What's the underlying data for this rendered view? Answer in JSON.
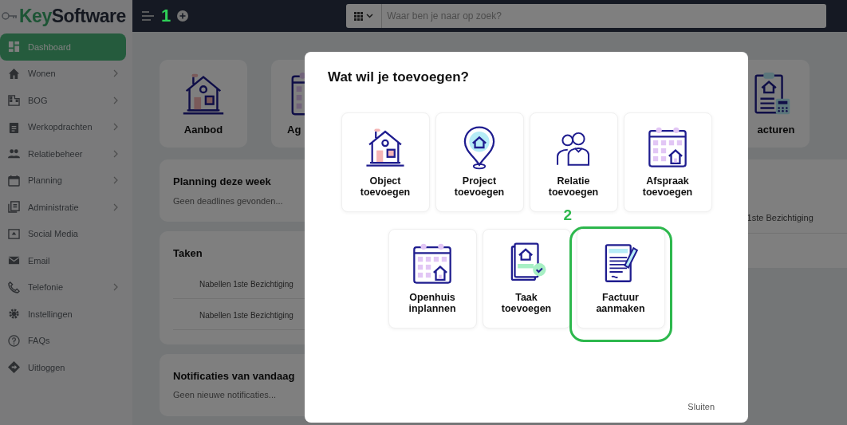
{
  "logo": {
    "prefix": "Key",
    "suffix": "Software"
  },
  "topbar": {
    "marker": "1",
    "search": {
      "placeholder": "Waar ben je naar op zoek?"
    }
  },
  "sidebar": {
    "items": [
      {
        "label": "Dashboard",
        "selected": true,
        "submenu": false
      },
      {
        "label": "Wonen",
        "selected": false,
        "submenu": true
      },
      {
        "label": "BOG",
        "selected": false,
        "submenu": true
      },
      {
        "label": "Werkopdrachten",
        "selected": false,
        "submenu": true
      },
      {
        "label": "Relatiebeheer",
        "selected": false,
        "submenu": true
      },
      {
        "label": "Planning",
        "selected": false,
        "submenu": true
      },
      {
        "label": "Administratie",
        "selected": false,
        "submenu": true
      },
      {
        "label": "Social Media",
        "selected": false,
        "submenu": false
      },
      {
        "label": "Email",
        "selected": false,
        "submenu": false
      },
      {
        "label": "Telefonie",
        "selected": false,
        "submenu": true
      },
      {
        "label": "Instellingen",
        "selected": false,
        "submenu": false
      },
      {
        "label": "FAQs",
        "selected": false,
        "submenu": false
      },
      {
        "label": "Uitloggen",
        "selected": false,
        "submenu": false
      }
    ]
  },
  "dashboard": {
    "tiles": [
      {
        "label": "Aanbod"
      },
      {
        "label": "Ag"
      },
      {
        "label": "acturen"
      }
    ],
    "cards": [
      {
        "title": "Planning deze week",
        "text": "Geen deadlines gevonden..."
      },
      {
        "title": "Taken",
        "rows": [
          "Nabellen 1ste Bezichtiging",
          "Nabellen 1ste Bezichtiging"
        ]
      },
      {
        "title": "Notificaties van vandaag",
        "text": "Geen nieuwe notificaties..."
      }
    ],
    "side_rows": [
      "1ste Bezichtiging"
    ]
  },
  "modal": {
    "title": "Wat wil je toevoegen?",
    "rows": [
      [
        {
          "label": "Object toevoegen",
          "highlighted": false
        },
        {
          "label": "Project toevoegen",
          "highlighted": false
        },
        {
          "label": "Relatie toevoegen",
          "highlighted": false
        },
        {
          "label": "Afspraak toevoegen",
          "highlighted": false
        }
      ],
      [
        {
          "label": "Openhuis inplannen",
          "highlighted": false
        },
        {
          "label": "Taak toevoegen",
          "highlighted": false
        },
        {
          "label": "Factuur aanmaken",
          "highlighted": true,
          "marker": "2"
        }
      ]
    ],
    "close": "Sluiten"
  }
}
